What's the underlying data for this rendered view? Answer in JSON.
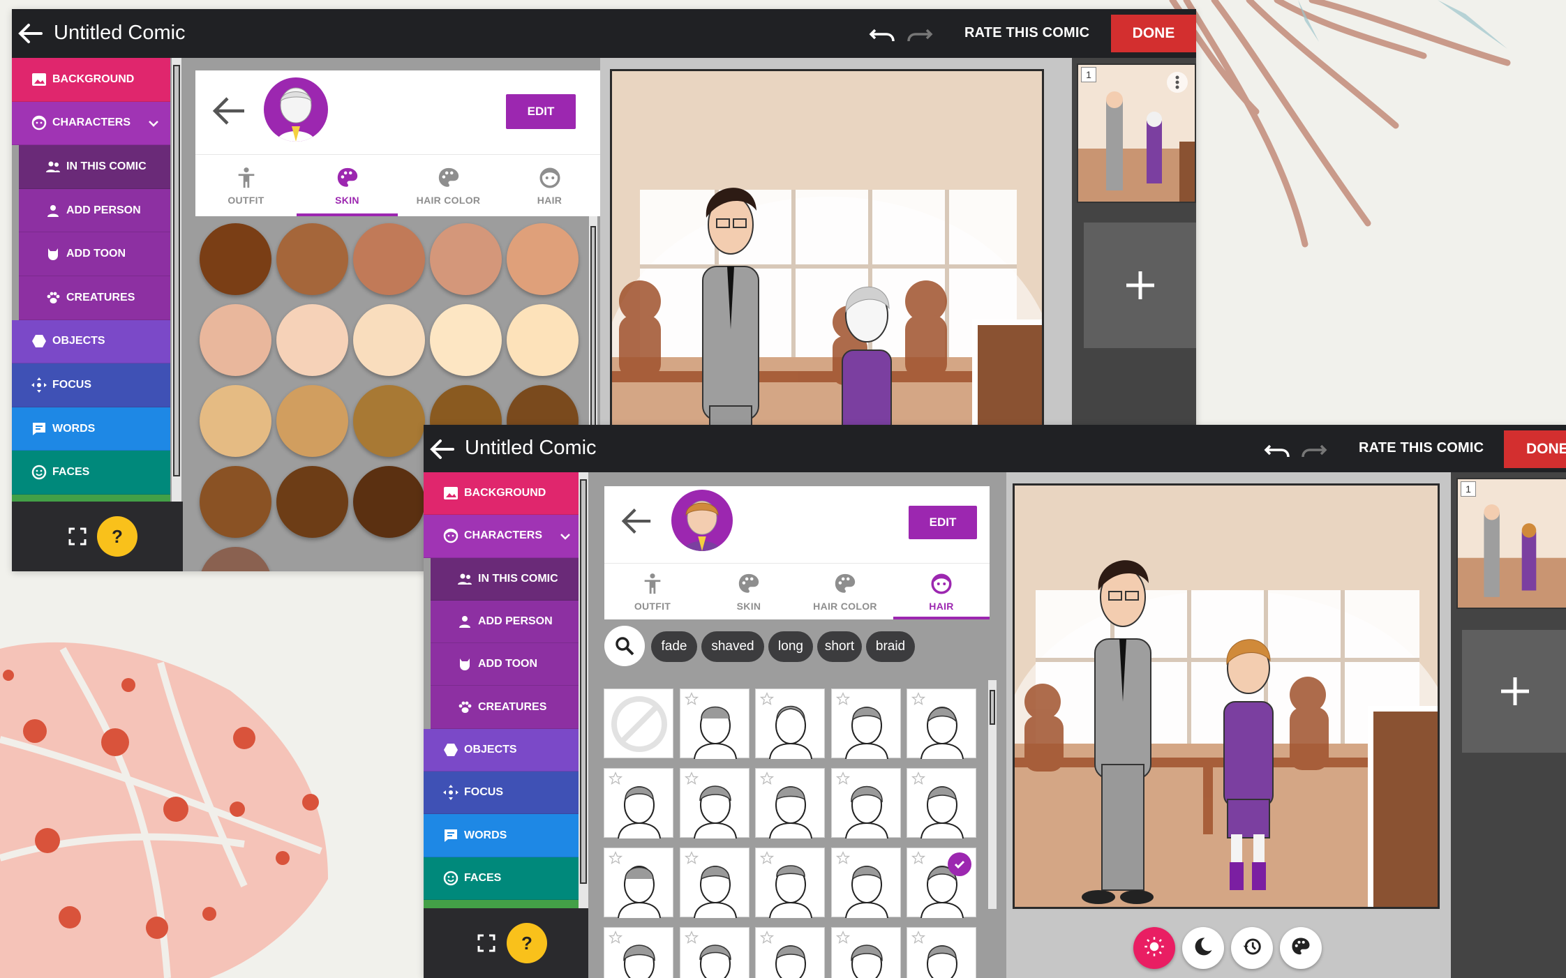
{
  "app": {
    "title": "Untitled Comic"
  },
  "toolbar": {
    "rate_label": "RATE THIS COMIC",
    "done_label": "DONE"
  },
  "sidebar": {
    "items": [
      {
        "label": "BACKGROUND",
        "icon": "image-icon",
        "color": "#e0266d"
      },
      {
        "label": "CHARACTERS",
        "icon": "face-icon",
        "color": "#a034b4",
        "expanded": true
      },
      {
        "label": "IN THIS COMIC",
        "icon": "people-icon",
        "color": "#6a2a78",
        "sub": true
      },
      {
        "label": "ADD PERSON",
        "icon": "person-icon",
        "color": "#8d30a2",
        "sub": true
      },
      {
        "label": "ADD TOON",
        "icon": "cat-icon",
        "color": "#8d30a2",
        "sub": true
      },
      {
        "label": "CREATURES",
        "icon": "paw-icon",
        "color": "#8d30a2",
        "sub": true
      },
      {
        "label": "OBJECTS",
        "icon": "hexagon-icon",
        "color": "#7b49c8"
      },
      {
        "label": "FOCUS",
        "icon": "move-icon",
        "color": "#3f51b5"
      },
      {
        "label": "WORDS",
        "icon": "chat-icon",
        "color": "#1e88e5"
      },
      {
        "label": "FACES",
        "icon": "smile-icon",
        "color": "#00897b"
      }
    ],
    "help_label": "?"
  },
  "editor": {
    "edit_label": "EDIT",
    "tabs": [
      {
        "label": "OUTFIT",
        "icon": "figure-icon"
      },
      {
        "label": "SKIN",
        "icon": "palette-icon"
      },
      {
        "label": "HAIR COLOR",
        "icon": "palette-icon"
      },
      {
        "label": "HAIR",
        "icon": "face-icon"
      }
    ],
    "active_tab_top": "SKIN",
    "active_tab_bottom": "HAIR"
  },
  "skin_swatches": [
    "#7a3e15",
    "#a5663a",
    "#c17a58",
    "#d4977a",
    "#dfa07a",
    "#e9b79c",
    "#f6d2b8",
    "#f9ddbd",
    "#fde6c3",
    "#fde2ba",
    "#e5bb83",
    "#d19e5f",
    "#a87934",
    "#8a5a20",
    "#7a4a1d",
    "#8a5224",
    "#6d3d16",
    "#5b3011",
    "#4a2e1c",
    "#8a6150",
    "#8a6150"
  ],
  "hair_tags": [
    "fade",
    "shaved",
    "long",
    "short",
    "braid"
  ],
  "hair_selected_index": 14,
  "panels": {
    "thumb_number": "1"
  },
  "scene_controls": [
    "sun-icon",
    "moon-icon",
    "history-icon",
    "palette-icon"
  ],
  "colors": {
    "topbar": "#202124",
    "done": "#d32f2f",
    "accent": "#9c27b0",
    "help": "#f9c11b"
  }
}
